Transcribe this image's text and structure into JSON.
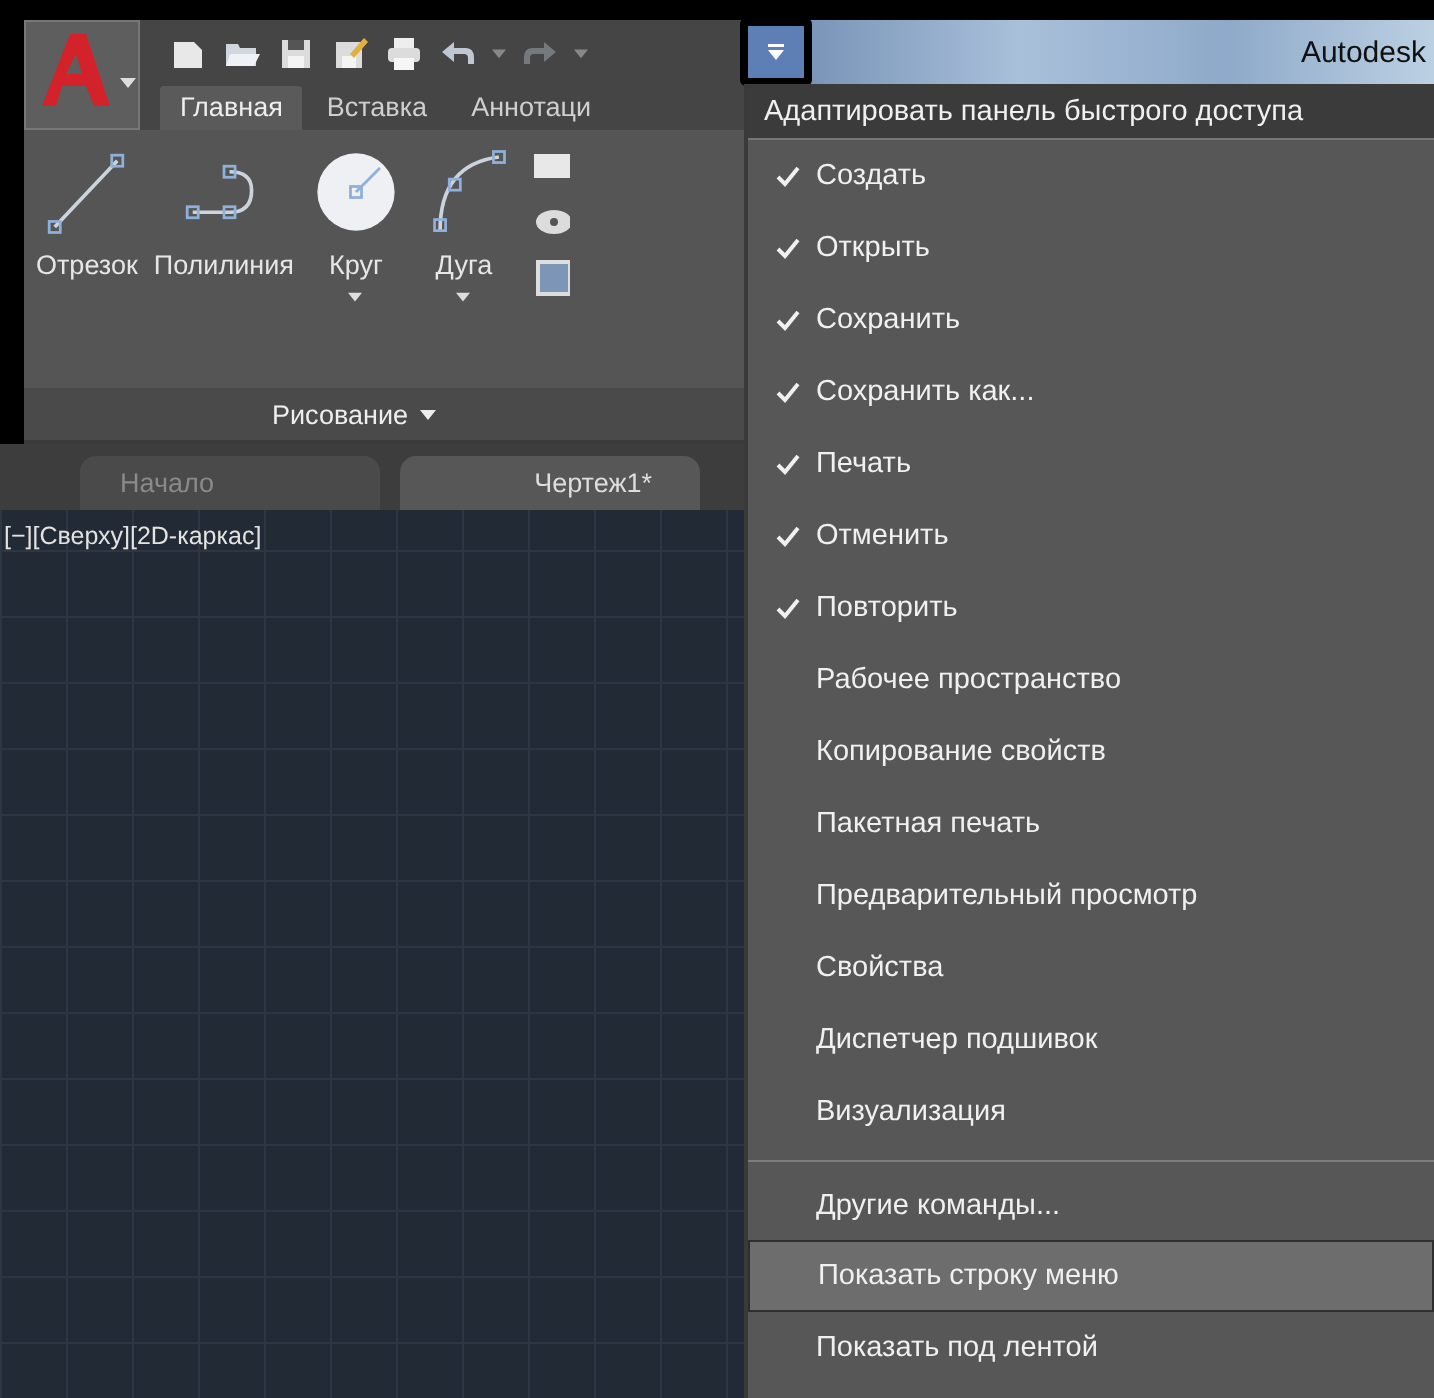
{
  "title": "Autodesk",
  "ribbon_tabs": [
    {
      "label": "Главная",
      "selected": true
    },
    {
      "label": "Вставка",
      "selected": false
    },
    {
      "label": "Аннотаци",
      "selected": false
    }
  ],
  "tools": [
    {
      "kind": "line",
      "label": "Отрезок",
      "dropdown": false
    },
    {
      "kind": "polyline",
      "label": "Полилиния",
      "dropdown": false
    },
    {
      "kind": "circle",
      "label": "Круг",
      "dropdown": true
    },
    {
      "kind": "arc",
      "label": "Дуга",
      "dropdown": true
    }
  ],
  "panel_title": "Рисование",
  "file_tabs": [
    {
      "label": "Начало",
      "selected": false
    },
    {
      "label": "Чертеж1*",
      "selected": true
    }
  ],
  "viewport_label": "[−][Сверху][2D-каркас]",
  "menu": {
    "title": "Адаптировать панель быстрого доступа",
    "items": [
      {
        "label": "Создать",
        "checked": true,
        "highlighted": false,
        "separator_before": false
      },
      {
        "label": "Открыть",
        "checked": true,
        "highlighted": false,
        "separator_before": false
      },
      {
        "label": "Сохранить",
        "checked": true,
        "highlighted": false,
        "separator_before": false
      },
      {
        "label": "Сохранить как...",
        "checked": true,
        "highlighted": false,
        "separator_before": false
      },
      {
        "label": "Печать",
        "checked": true,
        "highlighted": false,
        "separator_before": false
      },
      {
        "label": "Отменить",
        "checked": true,
        "highlighted": false,
        "separator_before": false
      },
      {
        "label": "Повторить",
        "checked": true,
        "highlighted": false,
        "separator_before": false
      },
      {
        "label": "Рабочее пространство",
        "checked": false,
        "highlighted": false,
        "separator_before": false
      },
      {
        "label": "Копирование свойств",
        "checked": false,
        "highlighted": false,
        "separator_before": false
      },
      {
        "label": "Пакетная печать",
        "checked": false,
        "highlighted": false,
        "separator_before": false
      },
      {
        "label": "Предварительный просмотр",
        "checked": false,
        "highlighted": false,
        "separator_before": false
      },
      {
        "label": "Свойства",
        "checked": false,
        "highlighted": false,
        "separator_before": false
      },
      {
        "label": "Диспетчер подшивок",
        "checked": false,
        "highlighted": false,
        "separator_before": false
      },
      {
        "label": "Визуализация",
        "checked": false,
        "highlighted": false,
        "separator_before": false
      },
      {
        "label": "Другие команды...",
        "checked": false,
        "highlighted": false,
        "separator_before": true
      },
      {
        "label": "Показать строку меню",
        "checked": false,
        "highlighted": true,
        "separator_before": false
      },
      {
        "label": "Показать под лентой",
        "checked": false,
        "highlighted": false,
        "separator_before": false
      }
    ]
  }
}
